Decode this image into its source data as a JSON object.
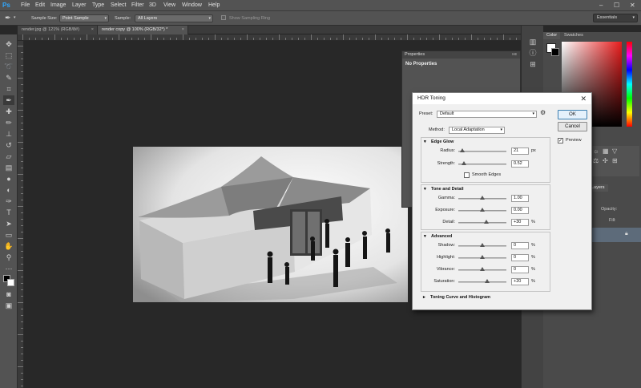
{
  "app": {
    "logo": "Ps",
    "menu": [
      "File",
      "Edit",
      "Image",
      "Layer",
      "Type",
      "Select",
      "Filter",
      "3D",
      "View",
      "Window",
      "Help"
    ],
    "window_controls": [
      "–",
      "☐",
      "✕"
    ]
  },
  "options_bar": {
    "sample_size_label": "Sample Size:",
    "sample_size_value": "Point Sample",
    "sample_label": "Sample:",
    "sample_value": "All Layers",
    "sampling_ring_label": "Show Sampling Ring",
    "workspace": "Essentials"
  },
  "tabs": [
    {
      "label": "render.jpg @ 121% (RGB/8#)",
      "close": "×"
    },
    {
      "label": "render copy @ 100% (RGB/32*) *",
      "close": "×"
    }
  ],
  "panels": {
    "color_tab": "Color",
    "swatches_tab": "Swatches",
    "layers_tab": "Layers",
    "opacity_label": "Opacity:",
    "fill_label": "Fill:"
  },
  "properties": {
    "title": "Properties",
    "body": "No Properties"
  },
  "hdr_dialog": {
    "title": "HDR Toning",
    "preset_label": "Preset:",
    "preset_value": "Default",
    "ok_label": "OK",
    "cancel_label": "Cancel",
    "preview_label": "Preview",
    "preview_checked": true,
    "method_label": "Method:",
    "method_value": "Local Adaptation",
    "edge_glow": {
      "title": "Edge Glow",
      "radius_label": "Radius:",
      "radius_value": "21",
      "radius_unit": "px",
      "radius_pos": 0.08,
      "strength_label": "Strength:",
      "strength_value": "0.52",
      "strength_pos": 0.12,
      "smooth_edges_label": "Smooth Edges"
    },
    "tone_detail": {
      "title": "Tone and Detail",
      "gamma_label": "Gamma:",
      "gamma_value": "1.00",
      "gamma_pos": 0.5,
      "exposure_label": "Exposure:",
      "exposure_value": "0.00",
      "exposure_pos": 0.5,
      "detail_label": "Detail:",
      "detail_value": "+30",
      "detail_unit": "%",
      "detail_pos": 0.58
    },
    "advanced": {
      "title": "Advanced",
      "shadow_label": "Shadow:",
      "shadow_value": "0",
      "shadow_unit": "%",
      "shadow_pos": 0.5,
      "highlight_label": "Highlight:",
      "highlight_value": "0",
      "highlight_unit": "%",
      "highlight_pos": 0.5,
      "vibrance_label": "Vibrance:",
      "vibrance_value": "0",
      "vibrance_unit": "%",
      "vibrance_pos": 0.5,
      "saturation_label": "Saturation:",
      "saturation_value": "+20",
      "saturation_unit": "%",
      "saturation_pos": 0.6
    },
    "toning_curve_title": "Toning Curve and Histogram"
  }
}
